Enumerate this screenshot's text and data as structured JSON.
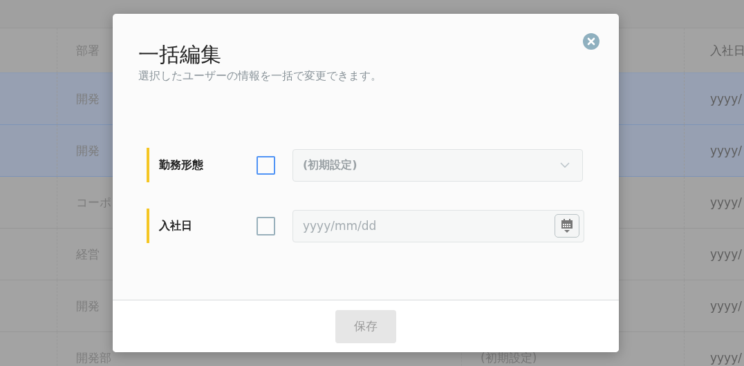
{
  "background_table": {
    "columns": [
      {
        "label": "部署"
      },
      {
        "label": "入社日"
      }
    ],
    "rows": [
      {
        "department": "開発",
        "hire_date": "yyyy/",
        "selected": true
      },
      {
        "department": "開発",
        "hire_date": "yyyy/",
        "selected": true
      },
      {
        "department": "コーポ",
        "hire_date": "yyyy/",
        "selected": false
      },
      {
        "department": "経営",
        "hire_date": "yyyy/",
        "selected": false
      },
      {
        "department": "開発",
        "hire_date": "yyyy/",
        "selected": false
      },
      {
        "department": "開発部",
        "employment_type": "(初期設定)",
        "hire_date": "yyyy/",
        "selected": false
      }
    ]
  },
  "dialog": {
    "title": "一括編集",
    "subtitle": "選択したユーザーの情報を一括で変更できます。",
    "fields": [
      {
        "label": "勤務形態",
        "kind": "select",
        "checked": false,
        "focused": true,
        "placeholder": "(初期設定)"
      },
      {
        "label": "入社日",
        "kind": "date",
        "checked": false,
        "focused": false,
        "placeholder": "yyyy/mm/dd"
      }
    ],
    "save_button": {
      "label": "保存",
      "disabled": true
    }
  }
}
